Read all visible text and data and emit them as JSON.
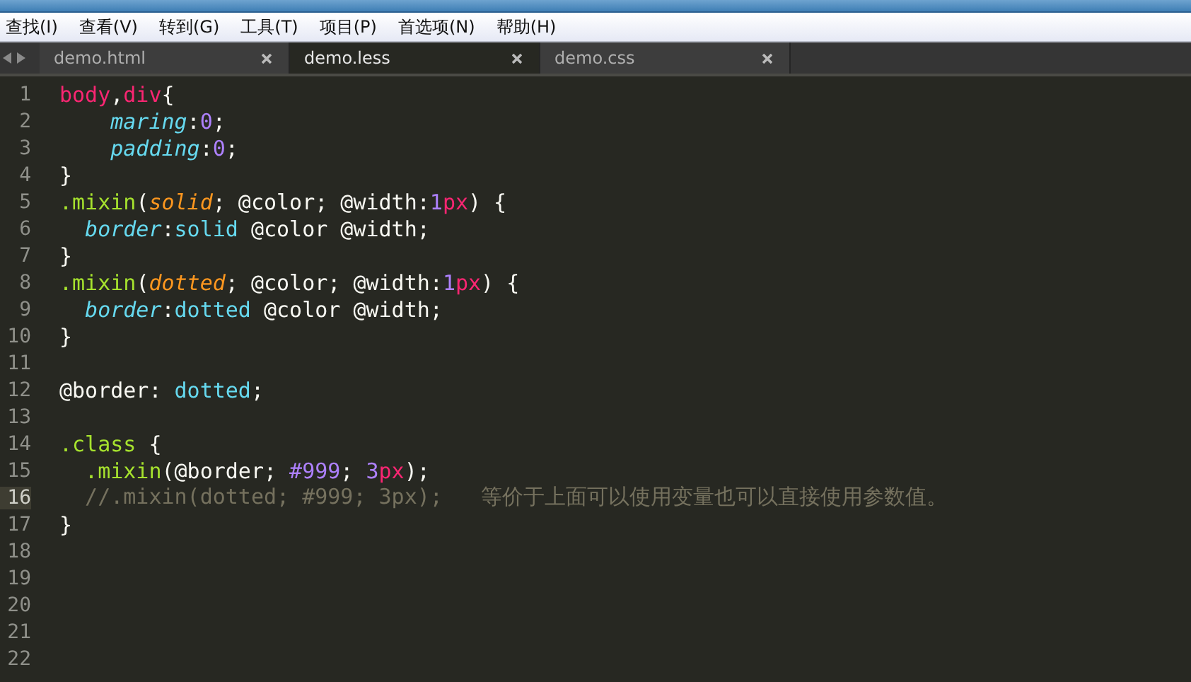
{
  "menu": [
    "查找(I)",
    "查看(V)",
    "转到(G)",
    "工具(T)",
    "项目(P)",
    "首选项(N)",
    "帮助(H)"
  ],
  "tabs": [
    {
      "label": "demo.html",
      "selected": false
    },
    {
      "label": "demo.less",
      "selected": true
    },
    {
      "label": "demo.css",
      "selected": false
    }
  ],
  "editor": {
    "lines": [
      {
        "number": "1",
        "current": false,
        "kind": "plain",
        "tokens": [
          {
            "text": "body",
            "kind": "tag"
          },
          {
            "text": ",",
            "kind": "text"
          },
          {
            "text": "div",
            "kind": "tag"
          },
          {
            "text": "{",
            "kind": "text"
          }
        ]
      },
      {
        "number": "2",
        "current": false,
        "kind": "deep",
        "tokens": [
          {
            "text": "maring",
            "kind": "prop"
          },
          {
            "text": ":",
            "kind": "text"
          },
          {
            "text": "0",
            "kind": "num"
          },
          {
            "text": ";",
            "kind": "text"
          }
        ]
      },
      {
        "number": "3",
        "current": false,
        "kind": "deep",
        "tokens": [
          {
            "text": "padding",
            "kind": "prop"
          },
          {
            "text": ":",
            "kind": "text"
          },
          {
            "text": "0",
            "kind": "num"
          },
          {
            "text": ";",
            "kind": "text"
          }
        ]
      },
      {
        "number": "4",
        "current": false,
        "kind": "plain",
        "tokens": [
          {
            "text": "}",
            "kind": "text"
          }
        ]
      },
      {
        "number": "5",
        "current": false,
        "kind": "plain",
        "tokens": [
          {
            "text": ".mixin",
            "kind": "fn"
          },
          {
            "text": "(",
            "kind": "text"
          },
          {
            "text": "solid",
            "kind": "param"
          },
          {
            "text": "; @color; @width:",
            "kind": "text"
          },
          {
            "text": "1",
            "kind": "num"
          },
          {
            "text": "px",
            "kind": "unit"
          },
          {
            "text": ") {",
            "kind": "text"
          }
        ]
      },
      {
        "number": "6",
        "current": false,
        "kind": "nested",
        "tokens": [
          {
            "text": "border",
            "kind": "prop"
          },
          {
            "text": ":",
            "kind": "text"
          },
          {
            "text": "solid",
            "kind": "val"
          },
          {
            "text": " @color @width;",
            "kind": "text"
          }
        ]
      },
      {
        "number": "7",
        "current": false,
        "kind": "plain",
        "tokens": [
          {
            "text": "}",
            "kind": "text"
          }
        ]
      },
      {
        "number": "8",
        "current": false,
        "kind": "plain",
        "tokens": [
          {
            "text": ".mixin",
            "kind": "fn"
          },
          {
            "text": "(",
            "kind": "text"
          },
          {
            "text": "dotted",
            "kind": "param"
          },
          {
            "text": "; @color; @width:",
            "kind": "text"
          },
          {
            "text": "1",
            "kind": "num"
          },
          {
            "text": "px",
            "kind": "unit"
          },
          {
            "text": ") {",
            "kind": "text"
          }
        ]
      },
      {
        "number": "9",
        "current": false,
        "kind": "nested",
        "tokens": [
          {
            "text": "border",
            "kind": "prop"
          },
          {
            "text": ":",
            "kind": "text"
          },
          {
            "text": "dotted",
            "kind": "val"
          },
          {
            "text": " @color @width;",
            "kind": "text"
          }
        ]
      },
      {
        "number": "10",
        "current": false,
        "kind": "plain",
        "tokens": [
          {
            "text": "}",
            "kind": "text"
          }
        ]
      },
      {
        "number": "11",
        "current": false,
        "kind": "plain"
      },
      {
        "number": "12",
        "current": false,
        "kind": "plain",
        "tokens": [
          {
            "text": "@border: ",
            "kind": "text"
          },
          {
            "text": "dotted",
            "kind": "val"
          },
          {
            "text": ";",
            "kind": "text"
          }
        ]
      },
      {
        "number": "13",
        "current": false,
        "kind": "plain"
      },
      {
        "number": "14",
        "current": false,
        "kind": "plain",
        "tokens": [
          {
            "text": ".class",
            "kind": "fn"
          },
          {
            "text": " {",
            "kind": "text"
          }
        ]
      },
      {
        "number": "15",
        "current": false,
        "kind": "nested",
        "tokens": [
          {
            "text": ".mixin",
            "kind": "fn"
          },
          {
            "text": "(@border; ",
            "kind": "text"
          },
          {
            "text": "#999",
            "kind": "num"
          },
          {
            "text": "; ",
            "kind": "text"
          },
          {
            "text": "3",
            "kind": "num"
          },
          {
            "text": "px",
            "kind": "unit"
          },
          {
            "text": ");",
            "kind": "text"
          }
        ]
      },
      {
        "number": "16",
        "current": true,
        "kind": "nested",
        "tokens": [
          {
            "text": "//.mixin(dotted; #999; 3px);   等价于上面可以使用变量也可以直接使用参数值。",
            "kind": "comment"
          }
        ]
      },
      {
        "number": "17",
        "current": false,
        "kind": "plain",
        "tokens": [
          {
            "text": "}",
            "kind": "text"
          }
        ]
      },
      {
        "number": "18",
        "current": false,
        "kind": "plain"
      },
      {
        "number": "19",
        "current": false,
        "kind": "plain"
      },
      {
        "number": "20",
        "current": false,
        "kind": "plain"
      },
      {
        "number": "21",
        "current": false,
        "kind": "plain"
      },
      {
        "number": "22",
        "current": false,
        "kind": "plain"
      }
    ]
  }
}
